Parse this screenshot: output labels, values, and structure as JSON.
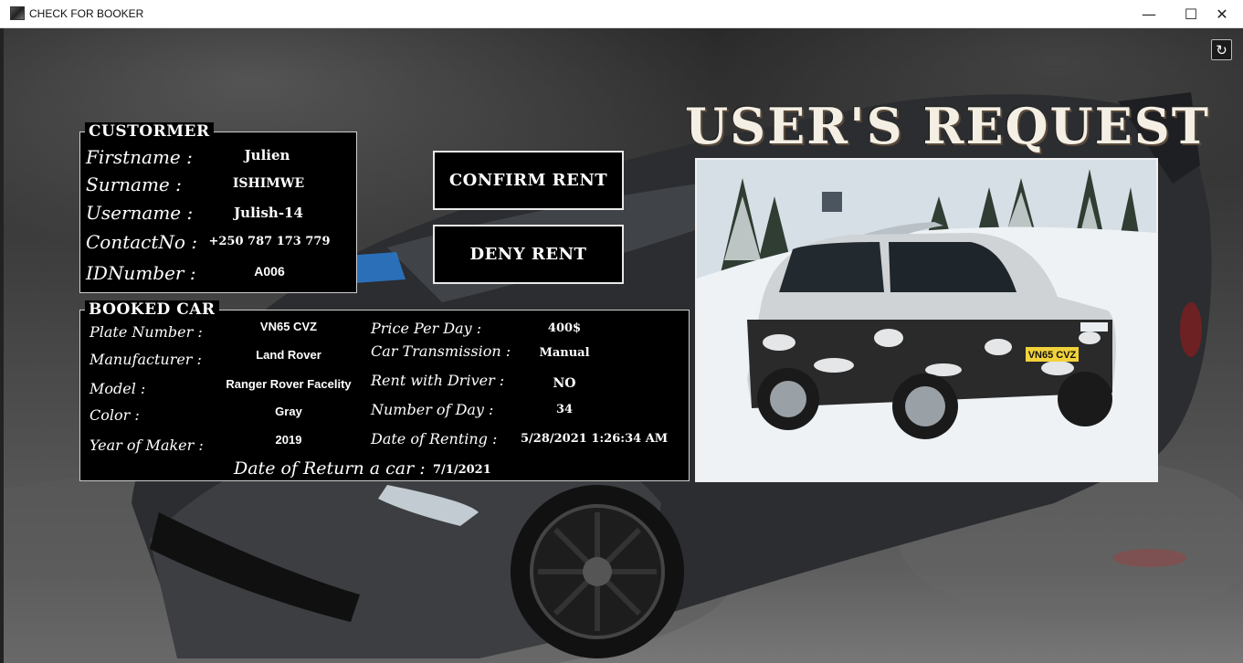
{
  "window": {
    "title": "CHECK FOR BOOKER",
    "minimize": "—",
    "maximize": "☐",
    "close": "✕"
  },
  "refresh_glyph": "↻",
  "heading": "USER'S  REQUEST",
  "customer": {
    "legend": "CUSTORMER",
    "fields": [
      {
        "label": "Firstname :",
        "value": "Julien"
      },
      {
        "label": "Surname :",
        "value": "ISHIMWE"
      },
      {
        "label": "Username :",
        "value": "Julish-14"
      },
      {
        "label": "ContactNo :",
        "value": "+250 787 173 779"
      },
      {
        "label": "IDNumber :",
        "value": "A006"
      }
    ]
  },
  "buttons": {
    "confirm": "CONFIRM RENT",
    "deny": "DENY RENT"
  },
  "booked_car": {
    "legend": "BOOKED CAR",
    "left_fields": [
      {
        "label": "Plate Number :",
        "value": "VN65 CVZ"
      },
      {
        "label": "Manufacturer :",
        "value": "Land Rover"
      },
      {
        "label": "Model :",
        "value": "Ranger Rover Facelity"
      },
      {
        "label": "Color :",
        "value": "Gray"
      },
      {
        "label": "Year of Maker :",
        "value": "2019"
      }
    ],
    "right_fields": [
      {
        "label": "Price Per Day :",
        "value": "400$"
      },
      {
        "label": "Car Transmission :",
        "value": "Manual"
      },
      {
        "label": "Rent with Driver :",
        "value": "NO"
      },
      {
        "label": "Number of Day :",
        "value": "34"
      },
      {
        "label": "Date of Renting :",
        "value": "5/28/2021 1:26:34 AM"
      }
    ],
    "return": {
      "label": "Date of Return a car :",
      "value": "7/1/2021"
    }
  },
  "car_photo": {
    "plate_text": "VN65 CVZ"
  }
}
